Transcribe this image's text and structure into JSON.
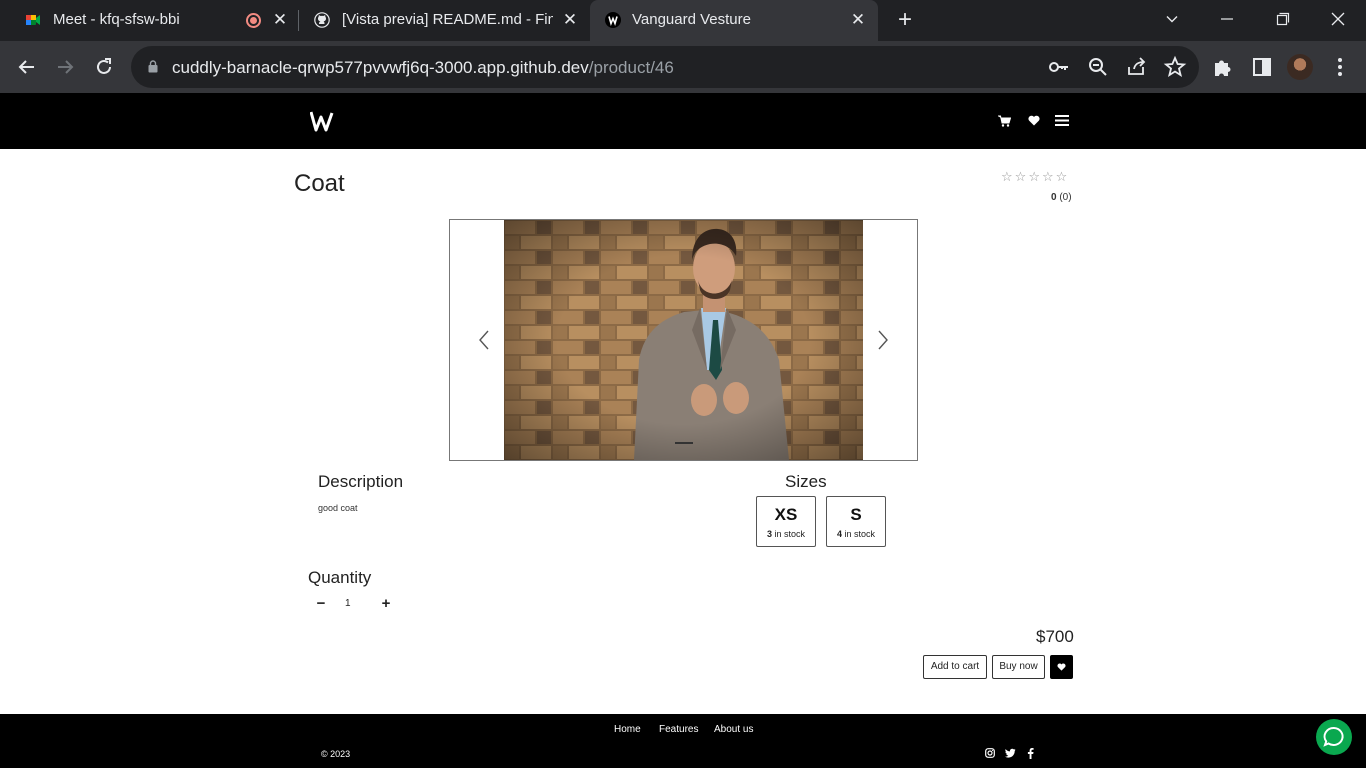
{
  "browser": {
    "tabs": [
      {
        "title": "Meet - kfq-sfsw-bbi",
        "icon": "google-meet-icon"
      },
      {
        "title": "[Vista previa] README.md - Final",
        "icon": "github-icon"
      },
      {
        "title": "Vanguard Vesture",
        "icon": "site-logo-icon",
        "active": true
      }
    ],
    "url_host": "cuddly-barnacle-qrwp577pvvwfj6q-3000.app.github.dev",
    "url_path": "/product/46"
  },
  "header": {
    "logo": "W",
    "icons": [
      "cart-icon",
      "heart-icon",
      "menu-icon"
    ]
  },
  "product": {
    "title": "Coat",
    "rating_value": "0",
    "rating_count": "(0)",
    "stars_total": 5,
    "description_title": "Description",
    "description": "good coat",
    "sizes_title": "Sizes",
    "sizes": [
      {
        "label": "XS",
        "stock": "3",
        "stock_suffix": "in stock"
      },
      {
        "label": "S",
        "stock": "4",
        "stock_suffix": "in stock"
      }
    ],
    "quantity_title": "Quantity",
    "quantity": "1",
    "price": "$700",
    "add_to_cart": "Add to cart",
    "buy_now": "Buy now"
  },
  "footer": {
    "links": [
      "Home",
      "Features",
      "About us"
    ],
    "copyright": "© 2023",
    "social": [
      "instagram-icon",
      "twitter-icon",
      "facebook-icon"
    ]
  },
  "colors": {
    "chrome_dark": "#202124",
    "chrome_toolbar": "#35363a",
    "site_black": "#000000",
    "chat_green": "#0aa84f"
  }
}
